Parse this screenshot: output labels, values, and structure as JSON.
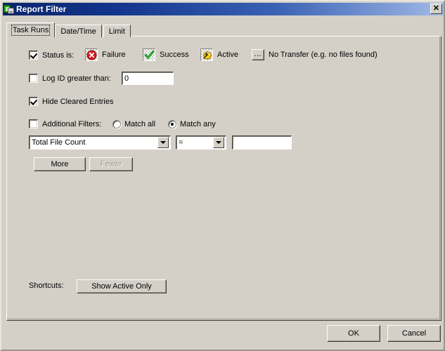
{
  "window": {
    "title": "Report Filter",
    "icon": "report-filter-icon",
    "close_label": "✕"
  },
  "tabs": [
    {
      "label": "Task Runs",
      "active": true
    },
    {
      "label": "Date/Time",
      "active": false
    },
    {
      "label": "Limit",
      "active": false
    }
  ],
  "task_runs": {
    "status": {
      "checkbox_label": "Status is:",
      "checked": true,
      "items": [
        {
          "label": "Failure",
          "icon": "failure-icon"
        },
        {
          "label": "Success",
          "icon": "success-icon"
        },
        {
          "label": "Active",
          "icon": "active-icon"
        },
        {
          "label": "No Transfer (e.g. no files found)",
          "icon": "no-transfer-icon"
        }
      ]
    },
    "log_id": {
      "checkbox_label": "Log ID greater than:",
      "checked": false,
      "value": "0"
    },
    "hide_cleared": {
      "checkbox_label": "Hide Cleared Entries",
      "checked": true
    },
    "additional_filters": {
      "checkbox_label": "Additional Filters:",
      "checked": false,
      "match_all_label": "Match all",
      "match_any_label": "Match any",
      "match_all_selected": false,
      "match_any_selected": true,
      "field_combo": {
        "value": "Total File Count"
      },
      "operator_combo": {
        "value": "="
      },
      "value_input": {
        "value": ""
      },
      "more_button": "More",
      "fewer_button": "Fewer",
      "fewer_disabled": true
    },
    "shortcuts": {
      "label": "Shortcuts:",
      "button": "Show Active Only"
    }
  },
  "footer": {
    "ok": "OK",
    "cancel": "Cancel"
  },
  "colors": {
    "face": "#d4d0c8",
    "title_start": "#0a246a",
    "title_end": "#a6bce8",
    "failure_red": "#d81820",
    "success_green": "#189018",
    "active_gold": "#f0c018"
  }
}
